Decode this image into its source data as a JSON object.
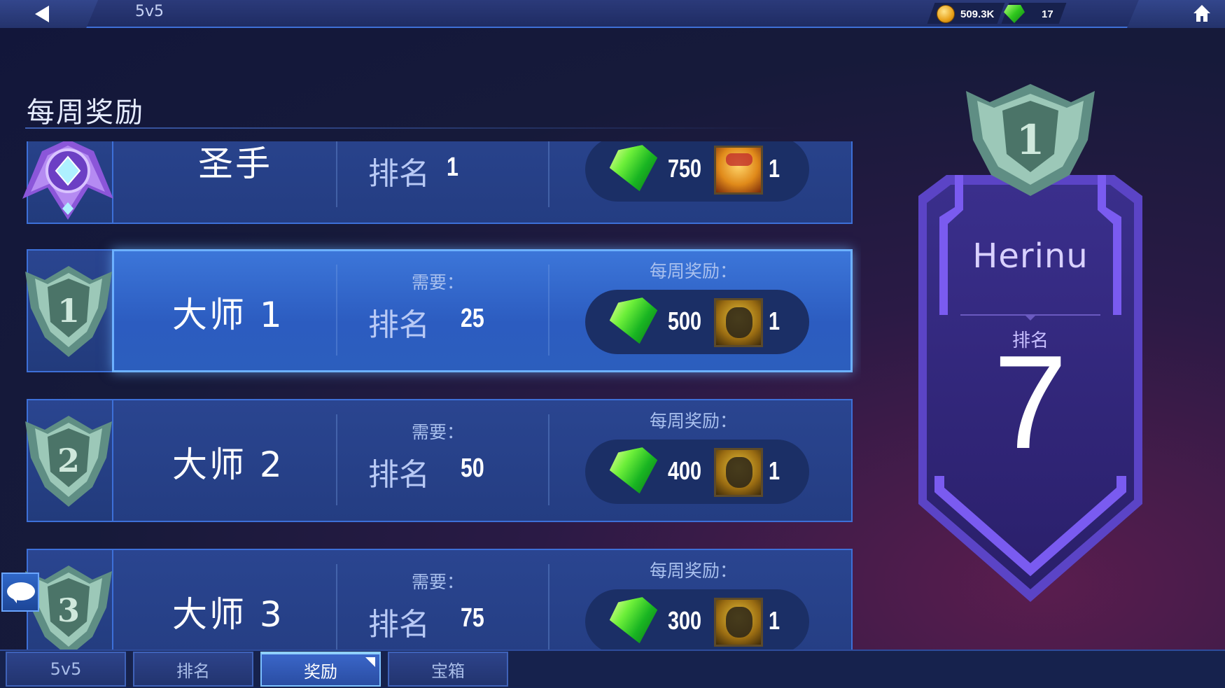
{
  "topbar": {
    "mode": "5v5",
    "gold": "509.3K",
    "gems": "17"
  },
  "section_title": "每周奖励",
  "rows": [
    {
      "title": "圣手",
      "required_label": "",
      "rank_label": "排名",
      "rank_value": "1",
      "reward_label": "",
      "gem_amount": "750",
      "fragment_count": "1",
      "badge": "purple-diamond-emblem"
    },
    {
      "title": "大师 1",
      "required_label": "需要：",
      "rank_label": "排名",
      "rank_value": "25",
      "reward_label": "每周奖励：",
      "gem_amount": "500",
      "fragment_count": "1",
      "badge": "shield-1",
      "active": true
    },
    {
      "title": "大师 2",
      "required_label": "需要：",
      "rank_label": "排名",
      "rank_value": "50",
      "reward_label": "每周奖励：",
      "gem_amount": "400",
      "fragment_count": "1",
      "badge": "shield-2"
    },
    {
      "title": "大师 3",
      "required_label": "需要：",
      "rank_label": "排名",
      "rank_value": "75",
      "reward_label": "每周奖励：",
      "gem_amount": "300",
      "fragment_count": "1",
      "badge": "shield-3"
    }
  ],
  "player_card": {
    "name": "Herinu",
    "rank_label": "排名",
    "rank_value": "7",
    "emblem_number": "1"
  },
  "tabs": [
    {
      "label": "5v5"
    },
    {
      "label": "排名"
    },
    {
      "label": "奖励",
      "active": true
    },
    {
      "label": "宝箱"
    }
  ],
  "colors": {
    "accent": "#3d70d8",
    "active_row": "#3c76d9",
    "card_purple": "#7a5bf0"
  }
}
